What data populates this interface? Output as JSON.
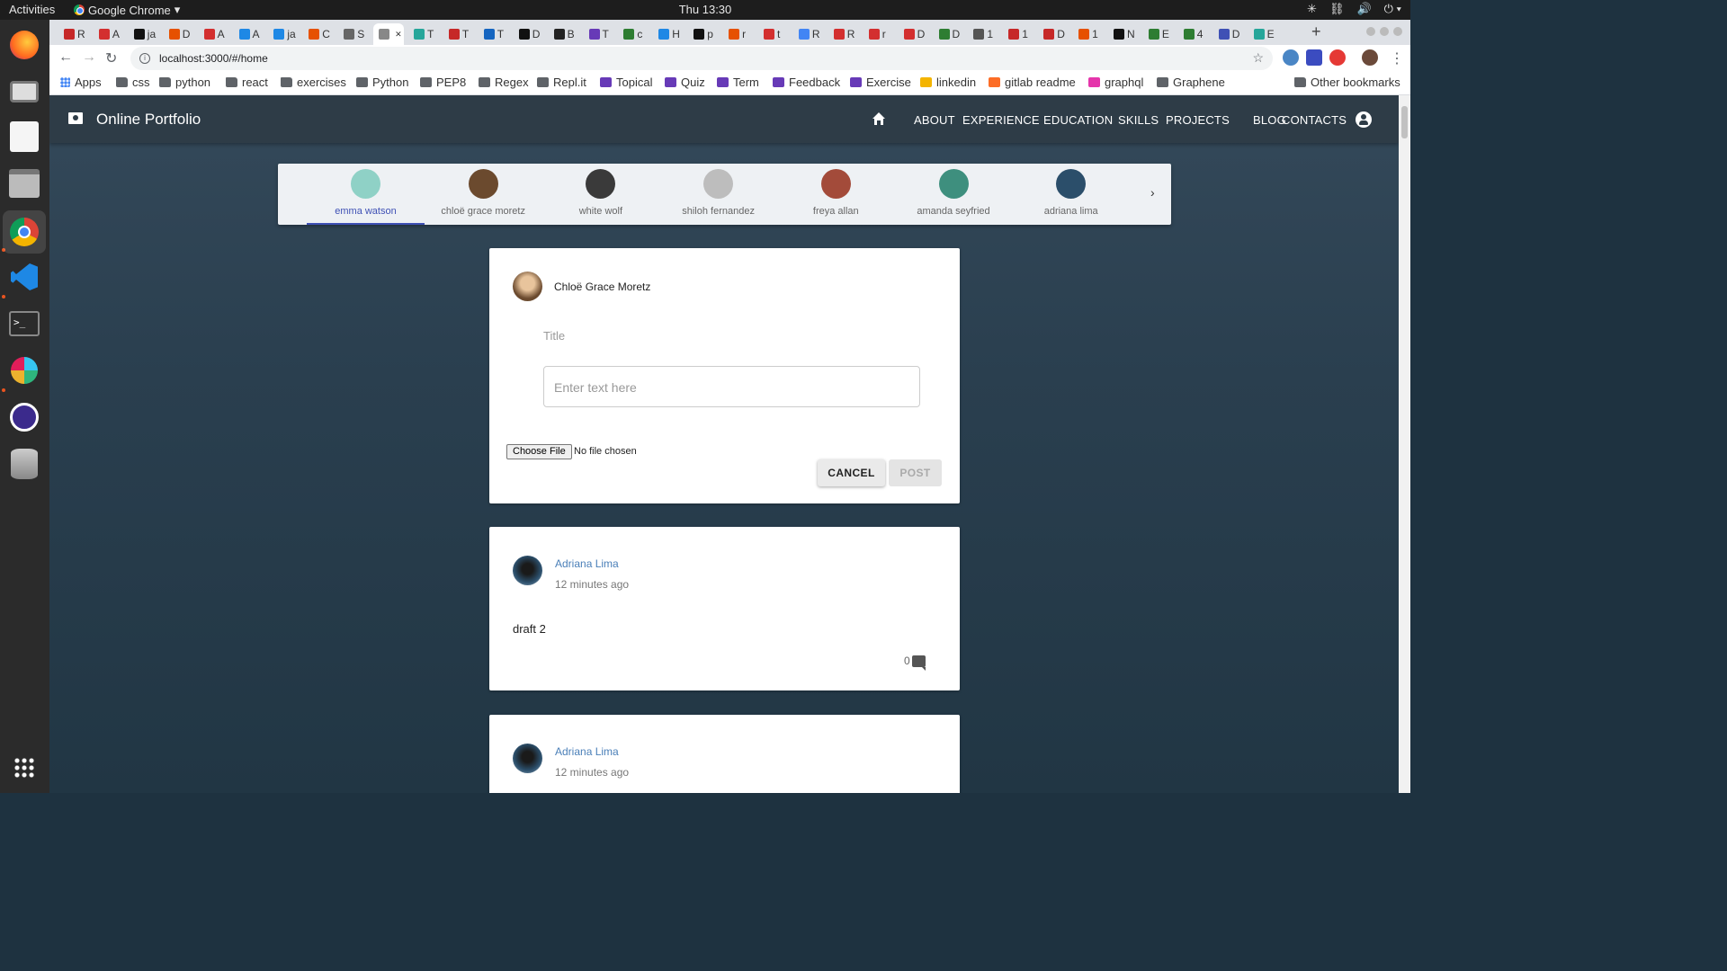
{
  "system_bar": {
    "activities": "Activities",
    "app_name": "Google Chrome",
    "clock": "Thu 13:30"
  },
  "browser": {
    "tabs": [
      "R",
      "A",
      "ja",
      "D",
      "A",
      "A",
      "ja",
      "C",
      "S",
      "",
      "T",
      "T",
      "T",
      "D",
      "B",
      "T",
      "c",
      "H",
      "p",
      "r",
      "t",
      "R",
      "R",
      "r",
      "D",
      "D",
      "1",
      "1",
      "D",
      "1",
      "N",
      "E",
      "4",
      "D",
      "E"
    ],
    "url": "localhost:3000/#/home",
    "bookmarks": [
      "Apps",
      "css",
      "python",
      "react",
      "exercises",
      "Python",
      "PEP8",
      "Regex",
      "Repl.it",
      "Topical",
      "Quiz",
      "Term",
      "Feedback",
      "Exercise",
      "linkedin",
      "gitlab readme",
      "graphql",
      "Graphene"
    ],
    "other_bookmarks": "Other bookmarks"
  },
  "app": {
    "brand": "Online Portfolio",
    "nav": [
      "ABOUT",
      "EXPERIENCE",
      "EDUCATION",
      "SKILLS",
      "PROJECTS",
      "BLOG",
      "CONTACTS"
    ],
    "users": [
      {
        "name": "emma watson",
        "color": "#8fd1c6",
        "selected": true
      },
      {
        "name": "chloë grace moretz",
        "color": "#6b4a2e",
        "selected": false
      },
      {
        "name": "white wolf",
        "color": "#3a3a3a",
        "selected": false
      },
      {
        "name": "shiloh fernandez",
        "color": "#bdbdbd",
        "selected": false
      },
      {
        "name": "freya allan",
        "color": "#a34b3a",
        "selected": false
      },
      {
        "name": "amanda seyfried",
        "color": "#3e8f7e",
        "selected": false
      },
      {
        "name": "adriana lima",
        "color": "#2b4e6a",
        "selected": false
      }
    ],
    "composer": {
      "author": "Chloë Grace Moretz",
      "title_placeholder": "Title",
      "text_placeholder": "Enter text here",
      "file_button": "Choose File",
      "file_status": "No file chosen",
      "cancel": "CANCEL",
      "post": "POST"
    },
    "posts": [
      {
        "author": "Adriana Lima",
        "time": "12 minutes ago",
        "body": "draft 2",
        "comments": "0"
      },
      {
        "author": "Adriana Lima",
        "time": "12 minutes ago"
      }
    ]
  },
  "colors": {
    "accent": "#3f51b5",
    "appbar": "#2e3c47",
    "author_link": "#4a7fb8"
  }
}
